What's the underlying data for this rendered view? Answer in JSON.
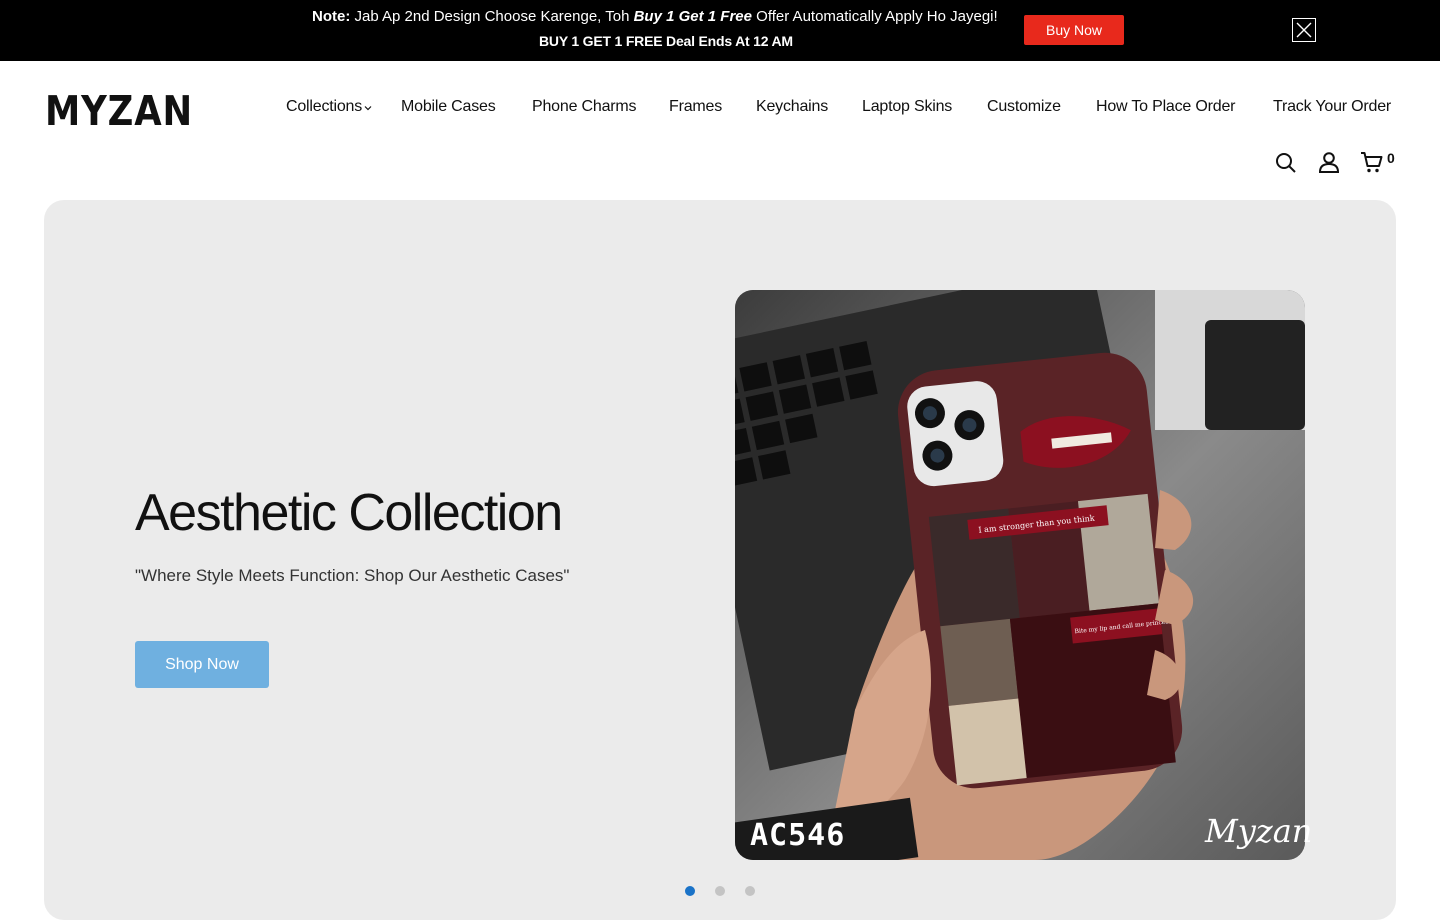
{
  "announcement": {
    "note_label": "Note:",
    "text_before": " Jab Ap 2nd Design Choose Karenge, Toh ",
    "offer": "Buy 1 Get 1 Free",
    "text_after": " Offer Automatically Apply Ho Jayegi!",
    "deal_line": "BUY 1 GET 1 FREE Deal Ends At 12 AM",
    "buy_label": "Buy Now",
    "close_icon": "close-icon"
  },
  "header": {
    "logo_text": "MYZAN",
    "nav": [
      {
        "label": "Collections",
        "has_dropdown": true
      },
      {
        "label": "Mobile Cases"
      },
      {
        "label": "Phone Charms"
      },
      {
        "label": "Frames"
      },
      {
        "label": "Keychains"
      },
      {
        "label": "Laptop Skins"
      },
      {
        "label": "Customize"
      },
      {
        "label": "How To Place Order"
      },
      {
        "label": "Track Your Order"
      }
    ],
    "icons": [
      "search-icon",
      "account-icon",
      "cart-icon"
    ],
    "cart_count": "0"
  },
  "hero": {
    "title": "Aesthetic Collection",
    "subtitle": "\"Where Style Meets Function: Shop Our Aesthetic Cases\"",
    "cta_label": "Shop Now",
    "image": {
      "code_label": "AC546",
      "brand_label": "Myzan",
      "case_text_1": "I am stronger than you think",
      "case_text_2": "Bite my lip and call me princess"
    },
    "slides_total": 3,
    "active_slide": 1
  },
  "colors": {
    "buy_button": "#e8291c",
    "cta": "#6fb0e0",
    "active_dot": "#1a73c8",
    "hero_bg": "#ebebeb"
  }
}
